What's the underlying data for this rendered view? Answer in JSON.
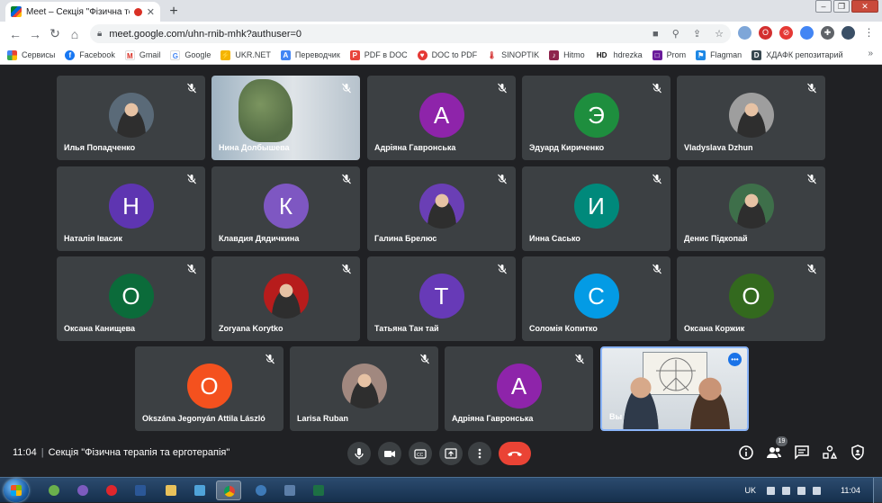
{
  "browser": {
    "tab": {
      "title": "Meet – Секція \"Фізична терапі",
      "recording": true
    },
    "url": "meet.google.com/uhn-rnib-mhk?authuser=0",
    "bookmarks": [
      {
        "label": "Сервисы",
        "color": "#ea4335"
      },
      {
        "label": "Facebook",
        "color": "#1877f2"
      },
      {
        "label": "Gmail",
        "color": "#d93025"
      },
      {
        "label": "Google",
        "color": "#4285f4"
      },
      {
        "label": "UKR.NET",
        "color": "#f4b400"
      },
      {
        "label": "Переводчик",
        "color": "#4285f4"
      },
      {
        "label": "PDF в DOC",
        "color": "#e8453c"
      },
      {
        "label": "DOC to PDF",
        "color": "#e53935"
      },
      {
        "label": "SINOPTIK",
        "color": "#d32f2f"
      },
      {
        "label": "Hitmo",
        "color": "#8e244d"
      },
      {
        "label": "hdrezka",
        "color": "#222222"
      },
      {
        "label": "Prom",
        "color": "#6a1b9a"
      },
      {
        "label": "Flagman",
        "color": "#1e88e5"
      },
      {
        "label": "ХДАФК репозитарий",
        "color": "#37474f"
      }
    ]
  },
  "participants": [
    {
      "name": "Илья Попадченко",
      "kind": "photo",
      "photo_bg": "#5a6a78"
    },
    {
      "name": "Нина Долбышева",
      "kind": "video"
    },
    {
      "name": "Адріяна Гавронська",
      "kind": "initial",
      "initial": "А",
      "color": "#8e24aa"
    },
    {
      "name": "Эдуард Кириченко",
      "kind": "initial",
      "initial": "Э",
      "color": "#1e8e3e"
    },
    {
      "name": "Vladyslava Dzhun",
      "kind": "photo",
      "photo_bg": "#9e9e9e"
    },
    {
      "name": "Наталія Івасик",
      "kind": "initial",
      "initial": "Н",
      "color": "#5e35b1"
    },
    {
      "name": "Клавдия Дядичкина",
      "kind": "initial",
      "initial": "К",
      "color": "#7e57c2"
    },
    {
      "name": "Галина Брелюс",
      "kind": "photo",
      "photo_bg": "#6a3fb5"
    },
    {
      "name": "Инна Сасько",
      "kind": "initial",
      "initial": "И",
      "color": "#00897b"
    },
    {
      "name": "Денис Підкопай",
      "kind": "photo",
      "photo_bg": "#3e6f4a"
    },
    {
      "name": "Оксана Канищева",
      "kind": "initial",
      "initial": "О",
      "color": "#0b6b3a"
    },
    {
      "name": "Zoryana Korytko",
      "kind": "photo",
      "photo_bg": "#b71c1c"
    },
    {
      "name": "Татьяна Тан тай",
      "kind": "initial",
      "initial": "Т",
      "color": "#673ab7"
    },
    {
      "name": "Соломія Копитко",
      "kind": "initial",
      "initial": "С",
      "color": "#039be5"
    },
    {
      "name": "Оксана Коржик",
      "kind": "initial",
      "initial": "О",
      "color": "#33691e"
    },
    {
      "name": "Okszána Jegonyán Attila László",
      "kind": "initial",
      "initial": "О",
      "color": "#f4511e"
    },
    {
      "name": "Larisa Ruban",
      "kind": "photo",
      "photo_bg": "#a1887f"
    },
    {
      "name": "Адріяна Гавронська",
      "kind": "initial",
      "initial": "А",
      "color": "#8e24aa"
    },
    {
      "name": "Вы",
      "kind": "self"
    }
  ],
  "meeting": {
    "time": "11:04",
    "title": "Секція \"Фізична терапія та ерготерапія\"",
    "participant_count": "19"
  },
  "taskbar": {
    "language": "UK",
    "clock": "11:04"
  }
}
